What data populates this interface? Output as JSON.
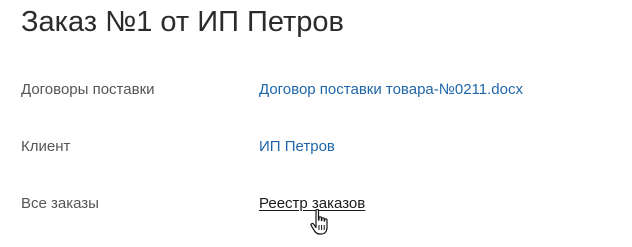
{
  "page": {
    "title": "Заказ №1 от ИП Петров"
  },
  "details": [
    {
      "label": "Договоры поставки",
      "value": "Договор поставки товара-№0211.docx"
    },
    {
      "label": "Клиент",
      "value": "ИП Петров"
    },
    {
      "label": "Все заказы",
      "value": "Реестр заказов"
    }
  ],
  "cursor": {
    "icon": "hand-pointer-icon"
  }
}
